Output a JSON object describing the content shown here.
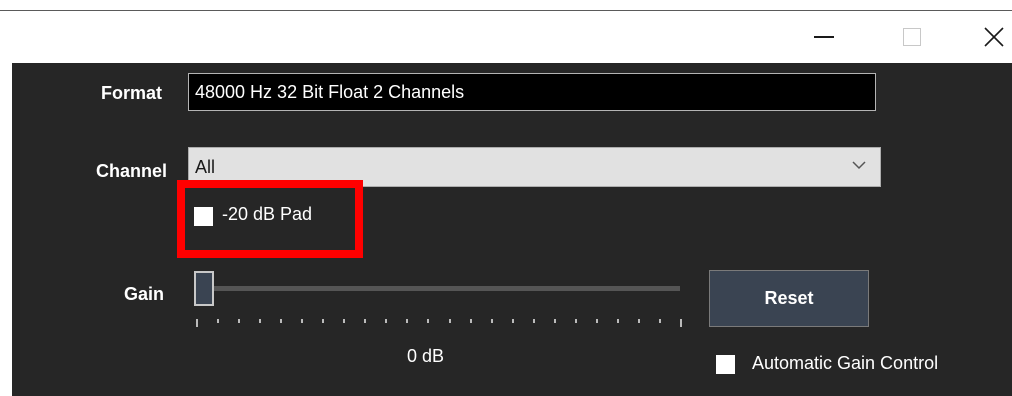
{
  "window": {
    "controls": [
      "minimize",
      "maximize",
      "close"
    ]
  },
  "format": {
    "label": "Format",
    "value": "48000 Hz 32 Bit Float 2 Channels"
  },
  "channel": {
    "label": "Channel",
    "selected": "All"
  },
  "pad": {
    "label": "-20 dB Pad",
    "checked": false
  },
  "gain": {
    "label": "Gain",
    "value_text": "0 dB",
    "slider_fraction": 0.0,
    "reset_label": "Reset"
  },
  "agc": {
    "label": "Automatic Gain Control",
    "checked": false
  },
  "colors": {
    "panel_background": "#262626",
    "highlight_border": "#ff0000",
    "button_background": "#3a4452"
  }
}
